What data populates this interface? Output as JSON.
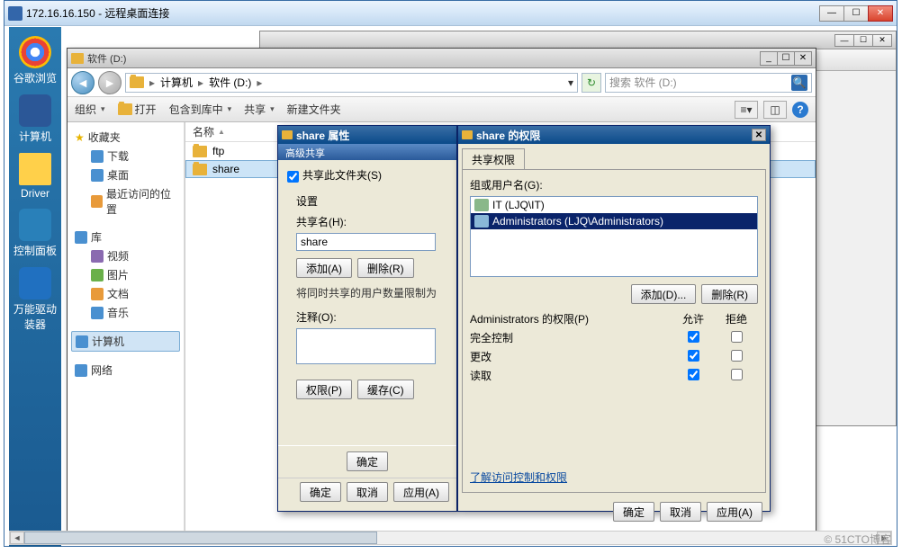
{
  "rdc": {
    "title": "172.16.16.150 - 远程桌面连接"
  },
  "desktop": {
    "icons": [
      "谷歌浏览",
      "计算机",
      "Driver",
      "控制面板",
      "万能驱动装器"
    ]
  },
  "explorer": {
    "title": "软件 (D:)",
    "breadcrumb": {
      "root": "计算机",
      "path": "软件 (D:)"
    },
    "search_placeholder": "搜索 软件 (D:)",
    "toolbar": {
      "organize": "组织",
      "open": "打开",
      "include": "包含到库中",
      "share": "共享",
      "newfolder": "新建文件夹"
    },
    "sidebar": {
      "favorites": "收藏夹",
      "fav_items": [
        "下载",
        "桌面",
        "最近访问的位置"
      ],
      "library": "库",
      "lib_items": [
        "视频",
        "图片",
        "文档",
        "音乐"
      ],
      "computer": "计算机",
      "network": "网络"
    },
    "column": "名称",
    "files": [
      "ftp",
      "share"
    ]
  },
  "props": {
    "title": "share 属性",
    "section": "高级共享",
    "share_chk": "共享此文件夹(S)",
    "settings": "设置",
    "sharename_label": "共享名(H):",
    "sharename": "share",
    "add": "添加(A)",
    "remove": "删除(R)",
    "limit_note": "将同时共享的用户数量限制为",
    "comment_label": "注释(O):",
    "perm_btn": "权限(P)",
    "cache_btn": "缓存(C)",
    "ok": "确定",
    "cancel": "取消",
    "apply": "应用(A)"
  },
  "perms": {
    "title": "share 的权限",
    "tab": "共享权限",
    "groups_label": "组或用户名(G):",
    "users": [
      {
        "name": "IT (LJQ\\IT)",
        "sel": false
      },
      {
        "name": "Administrators (LJQ\\Administrators)",
        "sel": true
      }
    ],
    "add": "添加(D)...",
    "remove": "删除(R)",
    "perm_for": "Administrators 的权限(P)",
    "allow": "允许",
    "deny": "拒绝",
    "rows": [
      {
        "label": "完全控制",
        "allow": true,
        "deny": false
      },
      {
        "label": "更改",
        "allow": true,
        "deny": false
      },
      {
        "label": "读取",
        "allow": true,
        "deny": false
      }
    ],
    "link": "了解访问控制和权限",
    "ok": "确定",
    "cancel": "取消",
    "apply": "应用(A)"
  },
  "watermark": "© 51CTO博客"
}
